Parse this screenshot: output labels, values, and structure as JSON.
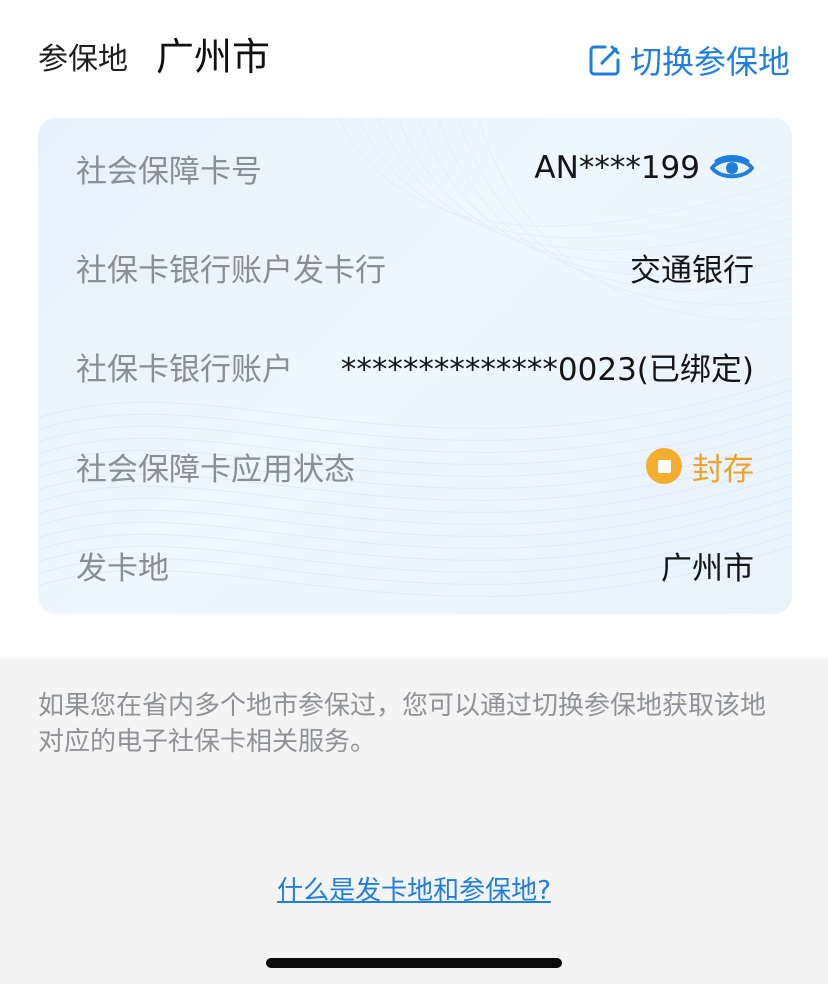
{
  "header": {
    "label": "参保地",
    "city": "广州市",
    "switch_label": "切换参保地"
  },
  "card": {
    "rows": [
      {
        "label": "社会保障卡号",
        "value": "AN****199"
      },
      {
        "label": "社保卡银行账户发卡行",
        "value": "交通银行"
      },
      {
        "label": "社保卡银行账户",
        "value": "**************0023(已绑定)"
      },
      {
        "label": "社会保障卡应用状态",
        "value": "封存"
      },
      {
        "label": "发卡地",
        "value": "广州市"
      }
    ]
  },
  "note": "如果您在省内多个地市参保过，您可以通过切换参保地获取该地对应的电子社保卡相关服务。",
  "help_link": "什么是发卡地和参保地?",
  "colors": {
    "accent": "#1f7fe0",
    "status": "#f5ad2d"
  },
  "icons": {
    "switch": "edit-icon",
    "card_number": "eye-icon",
    "status": "status-stop-icon"
  }
}
